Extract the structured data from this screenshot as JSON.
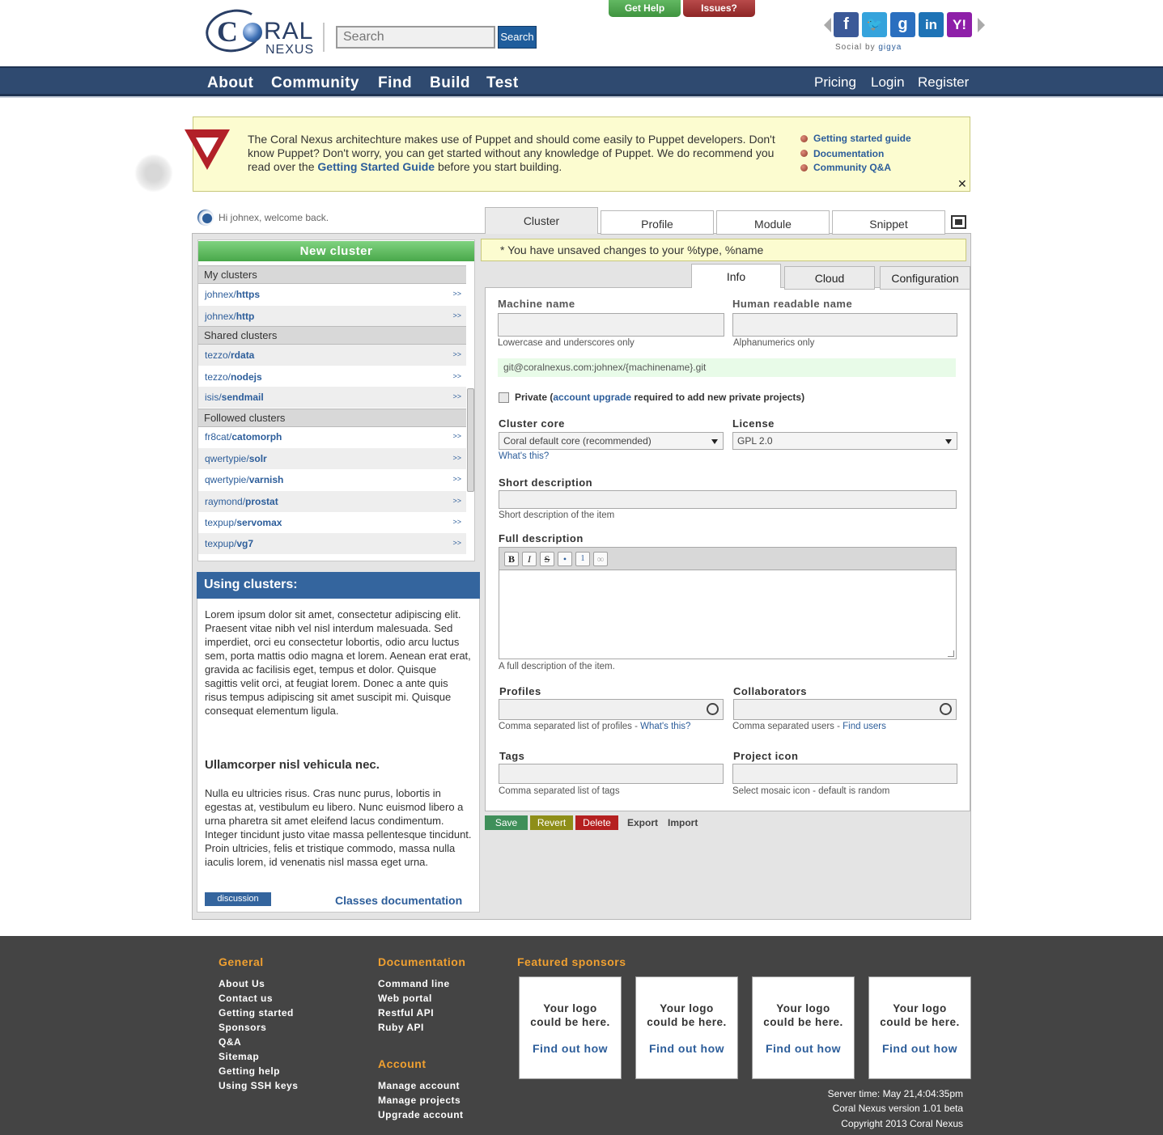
{
  "header": {
    "logo_text": "CORAL",
    "logo_sub": "NEXUS",
    "search_placeholder": "Search",
    "search_button": "Search",
    "get_help": "Get Help",
    "issues": "Issues?",
    "social_by": "Social by",
    "social_brand": "gigya",
    "social_icons": [
      "facebook-icon",
      "twitter-icon",
      "google-icon",
      "linkedin-icon",
      "yahoo-icon"
    ]
  },
  "nav": {
    "left": [
      "About",
      "Community",
      "Find",
      "Build",
      "Test"
    ],
    "right": [
      "Pricing",
      "Login",
      "Register"
    ]
  },
  "notice": {
    "text_before": "The Coral Nexus architechture makes use of Puppet and should come easily to Puppet developers. Don't know Puppet? Don't worry, you can get started without any knowledge of Puppet. We do recommend you read over the ",
    "text_link": "Getting Started Guide",
    "text_after": " before you start building.",
    "links": [
      "Getting started guide",
      "Documentation",
      "Community Q&A"
    ],
    "close": "✕"
  },
  "sidebar": {
    "welcome": "Hi johnex, welcome back.",
    "new_cluster": "New cluster",
    "groups": {
      "my": "My clusters",
      "shared": "Shared clusters",
      "followed": "Followed clusters"
    },
    "my_clusters": [
      {
        "owner": "johnex/",
        "name": "https"
      },
      {
        "owner": "johnex/",
        "name": "http"
      }
    ],
    "shared_clusters": [
      {
        "owner": "tezzo/",
        "name": "rdata"
      },
      {
        "owner": "tezzo/",
        "name": "nodejs"
      },
      {
        "owner": "isis/",
        "name": "sendmail"
      }
    ],
    "followed_clusters": [
      {
        "owner": "fr8cat/",
        "name": "catomorph"
      },
      {
        "owner": "qwertypie/",
        "name": "solr"
      },
      {
        "owner": "qwertypie/",
        "name": "varnish"
      },
      {
        "owner": "raymond/",
        "name": "prostat"
      },
      {
        "owner": "texpup/",
        "name": "servomax"
      },
      {
        "owner": "texpup/",
        "name": "vg7"
      }
    ],
    "arrow": ">>"
  },
  "using": {
    "title": "Using clusters:",
    "p1": "Lorem ipsum dolor sit amet, consectetur adipiscing elit. Praesent vitae nibh vel nisl interdum malesuada. Sed imperdiet, orci eu consectetur lobortis, odio arcu luctus sem, porta mattis odio magna et lorem. Aenean erat erat, gravida ac facilisis eget, tempus et dolor. Quisque sagittis velit orci, at feugiat lorem. Donec a ante quis risus tempus adipiscing sit amet suscipit mi. Quisque consequat elementum ligula.",
    "heading": "Ullamcorper nisl vehicula nec.",
    "p2": "Nulla eu ultricies risus. Cras nunc purus, lobortis in egestas at, vestibulum eu libero. Nunc euismod libero a urna pharetra sit amet eleifend lacus condimentum. Integer tincidunt justo vitae massa pellentesque tincidunt. Proin ultricies, felis et tristique commodo, massa nulla iaculis lorem, id venenatis nisl massa eget urna.",
    "discussion": "discussion",
    "classes": "Classes documentation"
  },
  "tabs": [
    "Cluster",
    "Profile",
    "Module",
    "Snippet"
  ],
  "unsaved": "* You have unsaved changes to your %type, %name",
  "subtabs": [
    "Info",
    "Cloud",
    "Configuration"
  ],
  "form": {
    "machine_name_label": "Machine name",
    "machine_name_hint": "Lowercase and underscores only",
    "human_name_label": "Human readable name",
    "human_name_hint": "Alphanumerics only",
    "git_url": "git@coralnexus.com:johnex/{machinename}.git",
    "private_pre": "Private (",
    "private_link": "account upgrade",
    "private_post": " required to add new private projects)",
    "core_label": "Cluster core",
    "core_value": "Coral default core (recommended)",
    "core_help": "What's this?",
    "license_label": "License",
    "license_value": "GPL 2.0",
    "short_label": "Short description",
    "short_hint": "Short description of the item",
    "full_label": "Full description",
    "full_hint": "A full description of the item.",
    "toolbar": [
      "B",
      "I",
      "S",
      "•",
      "1",
      "∞"
    ],
    "profiles_label": "Profiles",
    "profiles_hint": "Comma separated list of profiles - ",
    "profiles_help": "What's this?",
    "collab_label": "Collaborators",
    "collab_hint": "Comma separated users - ",
    "collab_help": "Find users",
    "tags_label": "Tags",
    "tags_hint": "Comma separated list of tags",
    "icon_label": "Project icon",
    "icon_hint": "Select mosaic icon - default is random"
  },
  "actions": {
    "save": "Save",
    "revert": "Revert",
    "delete": "Delete",
    "export": "Export",
    "import": "Import"
  },
  "colors": {
    "save": "#3f8f5a",
    "revert": "#8e8e18",
    "delete": "#b52020",
    "nav": "#2f4a70",
    "accent": "#2c5d9a"
  },
  "footer": {
    "general_title": "General",
    "general": [
      "About Us",
      "Contact us",
      "Getting started",
      "Sponsors",
      "Q&A",
      "Sitemap",
      "Getting help",
      "Using SSH keys"
    ],
    "docs_title": "Documentation",
    "docs": [
      "Command line",
      "Web portal",
      "Restful API",
      "Ruby API"
    ],
    "account_title": "Account",
    "account": [
      "Manage account",
      "Manage projects",
      "Upgrade account"
    ],
    "sponsors_title": "Featured sponsors",
    "sponsor_text_1": "Your logo",
    "sponsor_text_2": "could be here.",
    "sponsor_link": "Find out how",
    "server_time": "Server time: May 21,4:04:35pm",
    "version": "Coral Nexus version 1.01 beta",
    "copyright": "Copyright 2013 Coral Nexus"
  }
}
